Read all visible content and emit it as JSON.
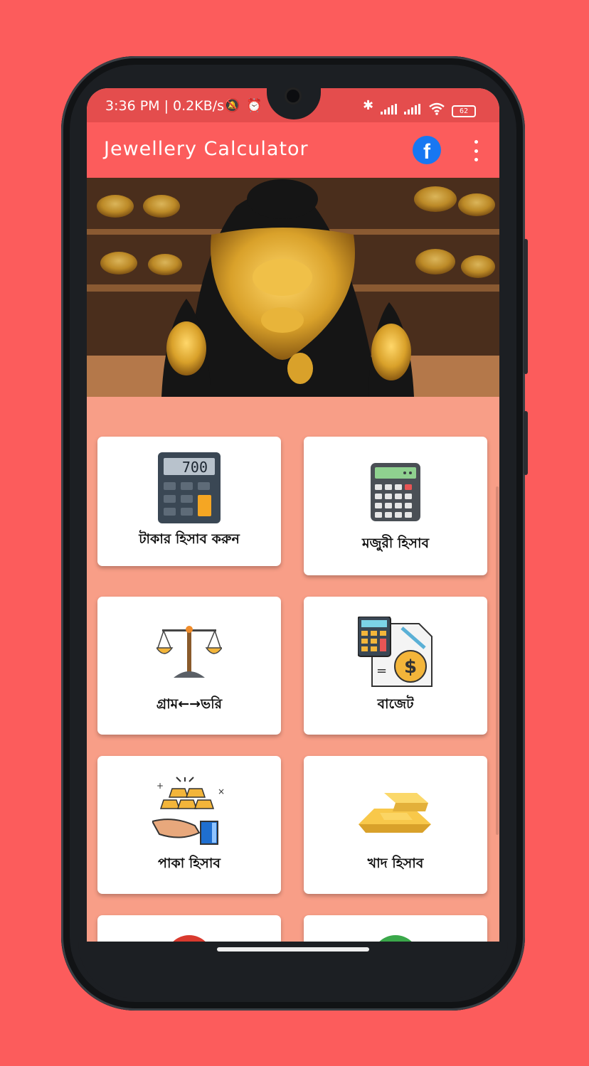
{
  "status_bar": {
    "time_and_speed": "3:36 PM | 0.2KB/s",
    "battery": "62"
  },
  "app_bar": {
    "title": "Jewellery Calculator",
    "facebook_glyph": "f",
    "icons": [
      "facebook-icon",
      "more-vert-icon"
    ]
  },
  "colors": {
    "app_bar": "#fc5c5c",
    "status_bar": "#e44d4d",
    "content_background": "#f89e87",
    "card_background": "#ffffff"
  },
  "cards": [
    {
      "label": "টাকার হিসাব করুন",
      "icon": "calculator-icon",
      "display": "700"
    },
    {
      "label": "মজুরী হিসাব",
      "icon": "calculator-keypad-icon"
    },
    {
      "label": "গ্রাম←→ভরি",
      "icon": "balance-scale-icon"
    },
    {
      "label": "বাজেট",
      "icon": "budget-document-icon"
    },
    {
      "label": "পাকা হিসাব",
      "icon": "gold-bars-hand-icon"
    },
    {
      "label": "খাদ হিসাব",
      "icon": "gold-bar-icon"
    }
  ]
}
